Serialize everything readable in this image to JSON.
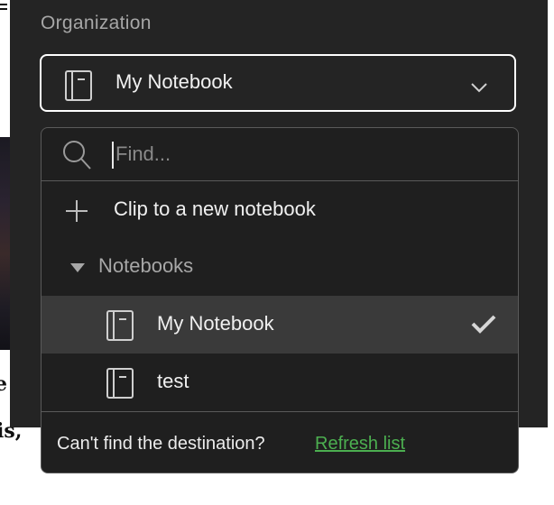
{
  "background": {
    "fragment_top": "e",
    "fragment_bottom": "is,"
  },
  "organization": {
    "label": "Organization"
  },
  "selector": {
    "selected": "My Notebook",
    "icon": "notebook-icon",
    "chevron": "chevron-down-icon"
  },
  "dropdown": {
    "search_placeholder": "Find...",
    "search_value": "",
    "clip_new": "Clip to a new notebook",
    "section_label": "Notebooks",
    "notebooks": [
      {
        "label": "My Notebook",
        "selected": true
      },
      {
        "label": "test",
        "selected": false
      }
    ],
    "footer_message": "Can't find the destination?",
    "refresh_label": "Refresh list"
  },
  "colors": {
    "panel": "#242424",
    "dropdown": "#1f1f1f",
    "selected_row": "#3a3a3a",
    "link": "#4caf50"
  }
}
